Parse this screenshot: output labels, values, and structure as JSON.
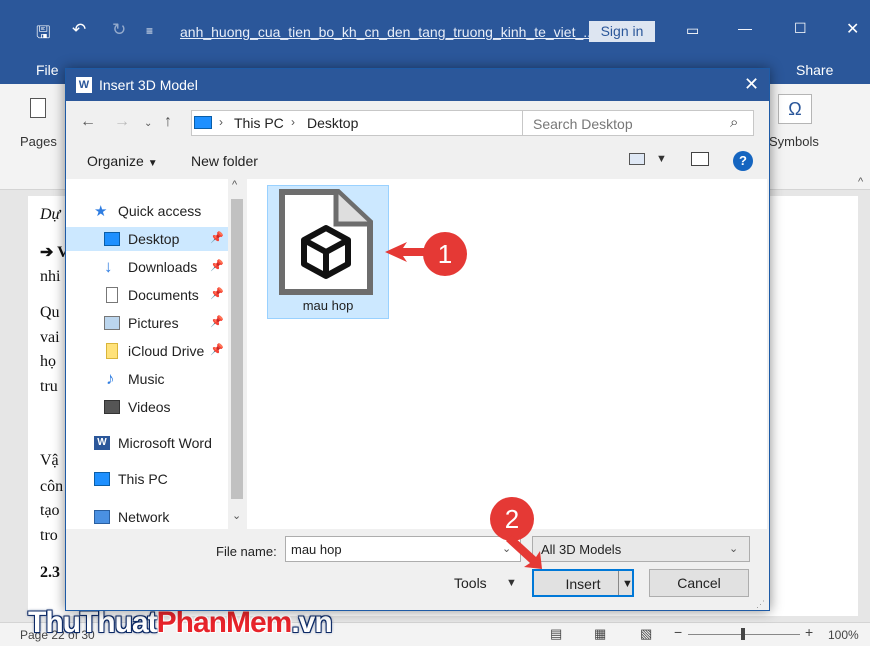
{
  "word": {
    "title": "anh_huong_cua_tien_bo_kh_cn_den_tang_truong_kinh_te_viet_...",
    "signin": "Sign in",
    "tab_file": "File",
    "share": "Share",
    "pages": "Pages",
    "symbols": "Symbols",
    "omega": "Ω",
    "doc_lines": [
      "Dự",
      "➔ V",
      "nhi",
      "Qu",
      "vai",
      "họ",
      "tru",
      "Vậ",
      "côn",
      "tạo",
      "tro",
      "2.3"
    ],
    "zoom": "100%",
    "status_left": "Page 22 of 30"
  },
  "dialog": {
    "title": "Insert 3D Model",
    "breadcrumb": [
      "This PC",
      "Desktop"
    ],
    "search_placeholder": "Search Desktop",
    "organize": "Organize",
    "new_folder": "New folder",
    "help": "?",
    "nav": [
      {
        "label": "Quick access",
        "icon": "star-icon"
      },
      {
        "label": "Desktop",
        "icon": "desktop-icon",
        "pinned": true,
        "selected": true
      },
      {
        "label": "Downloads",
        "icon": "download-icon",
        "pinned": true
      },
      {
        "label": "Documents",
        "icon": "document-icon",
        "pinned": true
      },
      {
        "label": "Pictures",
        "icon": "pictures-icon",
        "pinned": true
      },
      {
        "label": "iCloud Drive",
        "icon": "folder-icon",
        "pinned": true
      },
      {
        "label": "Music",
        "icon": "music-icon"
      },
      {
        "label": "Videos",
        "icon": "video-icon"
      },
      {
        "label": "Microsoft Word",
        "icon": "word-icon"
      },
      {
        "label": "This PC",
        "icon": "pc-icon"
      },
      {
        "label": "Network",
        "icon": "network-icon"
      }
    ],
    "file": {
      "name": "mau hop"
    },
    "file_name_label": "File name:",
    "file_name_value": "mau hop",
    "file_type": "All 3D Models",
    "tools": "Tools",
    "insert": "Insert",
    "cancel": "Cancel"
  },
  "markers": [
    "1",
    "2"
  ],
  "watermark": {
    "part1": "ThuThuat",
    "part2": "PhanMem",
    "part3": ".vn"
  },
  "colors": {
    "word_blue": "#2b579a",
    "selection": "#cce8ff",
    "marker_red": "#e53935"
  }
}
